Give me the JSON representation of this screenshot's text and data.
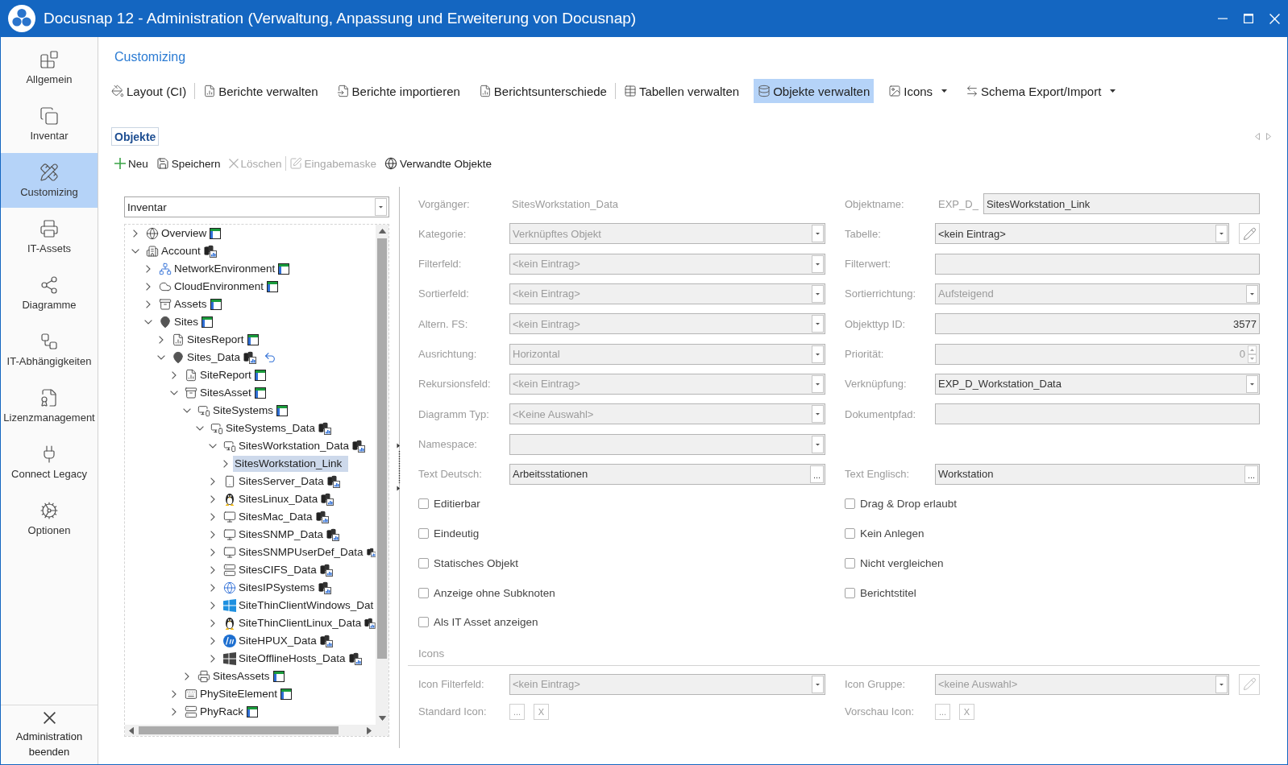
{
  "window": {
    "title": "Docusnap 12 - Administration (Verwaltung, Anpassung und Erweiterung von Docusnap)"
  },
  "sidebar": {
    "items": [
      {
        "label": "Allgemein",
        "selected": false
      },
      {
        "label": "Inventar",
        "selected": false
      },
      {
        "label": "Customizing",
        "selected": true
      },
      {
        "label": "IT-Assets",
        "selected": false
      },
      {
        "label": "Diagramme",
        "selected": false
      },
      {
        "label": "IT-Abhängigkeiten",
        "selected": false
      },
      {
        "label": "Lizenzmanagement",
        "selected": false
      },
      {
        "label": "Connect Legacy",
        "selected": false
      },
      {
        "label": "Optionen",
        "selected": false
      }
    ],
    "exit_button": {
      "label": "Administration beenden"
    }
  },
  "header": {
    "title": "Customizing"
  },
  "ribbon": {
    "groups": [
      {
        "items": [
          {
            "label": "Layout (CI)",
            "selected": false,
            "dropdown": false
          }
        ]
      },
      {
        "items": [
          {
            "label": "Berichte verwalten",
            "selected": false,
            "dropdown": false
          },
          {
            "label": "Berichte importieren",
            "selected": false,
            "dropdown": false
          },
          {
            "label": "Berichtsunterschiede",
            "selected": false,
            "dropdown": false
          }
        ]
      },
      {
        "items": [
          {
            "label": "Tabellen verwalten",
            "selected": false,
            "dropdown": false
          },
          {
            "label": "Objekte verwalten",
            "selected": true,
            "dropdown": false
          },
          {
            "label": "Icons",
            "selected": false,
            "dropdown": true
          },
          {
            "label": "Schema Export/Import",
            "selected": false,
            "dropdown": true
          }
        ]
      }
    ]
  },
  "tabs": [
    {
      "label": "Objekte",
      "selected": true
    }
  ],
  "toolbar": {
    "groups": [
      {
        "items": [
          {
            "label": "Neu",
            "disabled": false
          },
          {
            "label": "Speichern",
            "disabled": false
          },
          {
            "label": "Löschen",
            "disabled": true
          }
        ]
      },
      {
        "items": [
          {
            "label": "Eingabemaske",
            "disabled": true
          },
          {
            "label": "Verwandte Objekte",
            "disabled": false
          }
        ]
      }
    ]
  },
  "object_tree": {
    "category": "Inventar",
    "items": [
      {
        "label": "Overview",
        "kind": "table",
        "expanded": false,
        "selected": false,
        "modified": false
      },
      {
        "label": "Account",
        "kind": "data",
        "expanded": true,
        "selected": false,
        "modified": false,
        "children": [
          {
            "label": "NetworkEnvironment",
            "kind": "table",
            "expanded": false,
            "selected": false,
            "modified": false
          },
          {
            "label": "CloudEnvironment",
            "kind": "table",
            "expanded": false,
            "selected": false,
            "modified": false
          },
          {
            "label": "Assets",
            "kind": "table",
            "expanded": false,
            "selected": false,
            "modified": false
          },
          {
            "label": "Sites",
            "kind": "table",
            "expanded": true,
            "selected": false,
            "modified": false,
            "children": [
              {
                "label": "SitesReport",
                "kind": "table",
                "expanded": false,
                "selected": false,
                "modified": false
              },
              {
                "label": "Sites_Data",
                "kind": "data",
                "expanded": true,
                "selected": false,
                "modified": true,
                "children": [
                  {
                    "label": "SiteReport",
                    "kind": "table",
                    "expanded": false,
                    "selected": false,
                    "modified": false
                  },
                  {
                    "label": "SitesAsset",
                    "kind": "table",
                    "expanded": true,
                    "selected": false,
                    "modified": false,
                    "children": [
                      {
                        "label": "SiteSystems",
                        "kind": "table",
                        "expanded": true,
                        "selected": false,
                        "modified": false,
                        "children": [
                          {
                            "label": "SiteSystems_Data",
                            "kind": "data",
                            "expanded": true,
                            "selected": false,
                            "modified": false,
                            "children": [
                              {
                                "label": "SitesWorkstation_Data",
                                "kind": "data",
                                "expanded": true,
                                "selected": false,
                                "modified": false,
                                "children": [
                                  {
                                    "label": "SitesWorkstation_Link",
                                    "expanded": false,
                                    "selected": true,
                                    "modified": false
                                  }
                                ]
                              },
                              {
                                "label": "SitesServer_Data",
                                "kind": "data",
                                "expanded": false,
                                "selected": false,
                                "modified": false
                              },
                              {
                                "label": "SitesLinux_Data",
                                "kind": "data",
                                "expanded": false,
                                "selected": false,
                                "modified": false
                              },
                              {
                                "label": "SitesMac_Data",
                                "kind": "data",
                                "expanded": false,
                                "selected": false,
                                "modified": false
                              },
                              {
                                "label": "SitesSNMP_Data",
                                "kind": "data",
                                "expanded": false,
                                "selected": false,
                                "modified": false
                              },
                              {
                                "label": "SitesSNMPUserDef_Data",
                                "kind": "data",
                                "expanded": false,
                                "selected": false,
                                "modified": false
                              },
                              {
                                "label": "SitesCIFS_Data",
                                "kind": "data",
                                "expanded": false,
                                "selected": false,
                                "modified": false
                              },
                              {
                                "label": "SitesIPSystems",
                                "kind": "data",
                                "expanded": false,
                                "selected": false,
                                "modified": false
                              },
                              {
                                "label": "SiteThinClientWindows_Dat",
                                "expanded": false,
                                "selected": false,
                                "modified": false
                              },
                              {
                                "label": "SiteThinClientLinux_Data",
                                "kind": "data",
                                "expanded": false,
                                "selected": false,
                                "modified": false
                              },
                              {
                                "label": "SiteHPUX_Data",
                                "kind": "data",
                                "expanded": false,
                                "selected": false,
                                "modified": false
                              },
                              {
                                "label": "SiteOfflineHosts_Data",
                                "kind": "data",
                                "expanded": false,
                                "selected": false,
                                "modified": false
                              }
                            ]
                          }
                        ]
                      },
                      {
                        "label": "SitesAssets",
                        "kind": "table",
                        "expanded": false,
                        "selected": false,
                        "modified": false
                      }
                    ]
                  },
                  {
                    "label": "PhySiteElement",
                    "kind": "table",
                    "expanded": false,
                    "selected": false,
                    "modified": false
                  },
                  {
                    "label": "PhyRack",
                    "kind": "table",
                    "expanded": false,
                    "selected": false,
                    "modified": false
                  }
                ]
              }
            ]
          }
        ]
      }
    ]
  },
  "form": {
    "rows": [
      {
        "left": {
          "label": "Vorgänger:",
          "kind": "static",
          "value": "SitesWorkstation_Data"
        },
        "right": {
          "label": "Objektname:",
          "kind": "prefixed",
          "prefix": "EXP_D_",
          "value": "SitesWorkstation_Link",
          "disabled": false
        }
      },
      {
        "left": {
          "label": "Kategorie:",
          "kind": "combo",
          "value": "Verknüpftes Objekt",
          "disabled": true
        },
        "right": {
          "label": "Tabelle:",
          "kind": "combo_edit",
          "value": "<kein Eintrag>",
          "disabled": false
        }
      },
      {
        "left": {
          "label": "Filterfeld:",
          "kind": "combo",
          "value": "<kein Eintrag>",
          "disabled": true
        },
        "right": {
          "label": "Filterwert:",
          "kind": "text"
        }
      },
      {
        "left": {
          "label": "Sortierfeld:",
          "kind": "combo",
          "value": "<kein Eintrag>",
          "disabled": true
        },
        "right": {
          "label": "Sortierrichtung:",
          "kind": "combo",
          "value": "Aufsteigend",
          "disabled": true
        }
      },
      {
        "left": {
          "label": "Altern. FS:",
          "kind": "combo",
          "value": "<kein Eintrag>",
          "disabled": true
        },
        "right": {
          "label": "Objekttyp ID:",
          "kind": "number",
          "value": "3577",
          "disabled": false
        }
      },
      {
        "left": {
          "label": "Ausrichtung:",
          "kind": "combo",
          "value": "Horizontal",
          "disabled": true
        },
        "right": {
          "label": "Priorität:",
          "kind": "spin",
          "value": "0",
          "disabled": true
        }
      },
      {
        "left": {
          "label": "Rekursionsfeld:",
          "kind": "combo",
          "value": "<kein Eintrag>",
          "disabled": true
        },
        "right": {
          "label": "Verknüpfung:",
          "kind": "combo",
          "value": "EXP_D_Workstation_Data",
          "disabled": false
        }
      },
      {
        "left": {
          "label": "Diagramm Typ:",
          "kind": "combo",
          "value": "<Keine Auswahl>",
          "disabled": true
        },
        "right": {
          "label": "Dokumentpfad:",
          "kind": "text"
        }
      },
      {
        "left": {
          "label": "Namespace:",
          "kind": "combo"
        }
      },
      {
        "left": {
          "label": "Text Deutsch:",
          "kind": "ellipsis",
          "value": "Arbeitsstationen",
          "button": "...",
          "disabled": false
        },
        "right": {
          "label": "Text Englisch:",
          "kind": "ellipsis",
          "value": "Workstation",
          "button": "...",
          "disabled": false
        }
      }
    ]
  },
  "options": {
    "left": [
      {
        "label": "Editierbar",
        "checked": false
      },
      {
        "label": "Eindeutig",
        "checked": false
      },
      {
        "label": "Statisches Objekt",
        "checked": false
      },
      {
        "label": "Anzeige ohne Subknoten",
        "checked": false
      },
      {
        "label": "Als IT Asset anzeigen",
        "checked": false
      }
    ],
    "right": [
      {
        "label": "Drag & Drop erlaubt",
        "checked": false
      },
      {
        "label": "Kein Anlegen",
        "checked": false
      },
      {
        "label": "Nicht vergleichen",
        "checked": false
      },
      {
        "label": "Berichtstitel",
        "checked": false
      }
    ]
  },
  "icons_section": {
    "title": "Icons",
    "rows": [
      {
        "left": {
          "label": "Icon Filterfeld:",
          "kind": "combo",
          "value": "<kein Eintrag>",
          "disabled": true
        },
        "right": {
          "label": "Icon Gruppe:",
          "kind": "combo_edit",
          "value": "<keine Auswahl>",
          "disabled": true
        }
      },
      {
        "left": {
          "label": "Standard Icon:",
          "kind": "picker",
          "buttons": [
            "...",
            "X"
          ]
        },
        "right": {
          "label": "Vorschau Icon:",
          "kind": "picker",
          "buttons": [
            "...",
            "X"
          ]
        }
      }
    ]
  }
}
